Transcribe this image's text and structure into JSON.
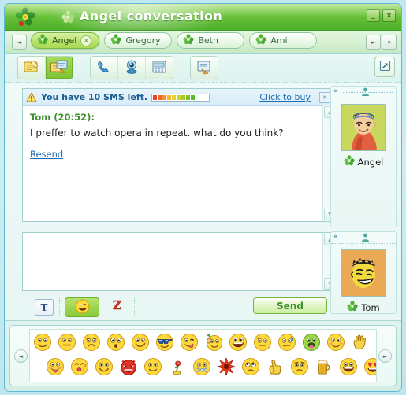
{
  "window": {
    "title": "Angel conversation",
    "logo_icon": "icq-flower-logo",
    "title_icon": "flower-icon",
    "minimize_label": "_",
    "close_label": "x"
  },
  "tabs": {
    "prev_label": "◄",
    "next_label": "►",
    "more_label": "»",
    "items": [
      {
        "label": "Angel",
        "active": true,
        "close_label": "×",
        "icon": "flower-icon"
      },
      {
        "label": "Gregory",
        "active": false,
        "icon": "flower-icon"
      },
      {
        "label": "Beth",
        "active": false,
        "icon": "flower-icon"
      },
      {
        "label": "Ami",
        "active": false,
        "icon": "flower-icon"
      }
    ]
  },
  "toolbar": {
    "buttons": [
      {
        "name": "send-file-button",
        "icon": "yellow-note-icon",
        "pressed": false
      },
      {
        "name": "send-contacts-button",
        "icon": "notes-stack-icon",
        "pressed": true
      },
      {
        "name": "voice-call-button",
        "icon": "phone-icon",
        "pressed": false
      },
      {
        "name": "video-call-button",
        "icon": "webcam-icon",
        "pressed": false
      },
      {
        "name": "send-sms-button",
        "icon": "sms-device-icon",
        "pressed": false
      },
      {
        "name": "history-button",
        "icon": "history-note-icon",
        "pressed": false
      }
    ],
    "expand_icon": "expand-arrow-icon"
  },
  "sms_bar": {
    "warning_icon": "warning-triangle-icon",
    "text": "You have 10 SMS left.",
    "buy_link": "Click to buy",
    "close_label": "×",
    "meter_total": 10,
    "meter_filled": 9,
    "meter_colors": [
      "#e8422a",
      "#f0682c",
      "#f5902e",
      "#f6b92f",
      "#e8cf33",
      "#c9d430",
      "#a6cc2e",
      "#7dc22c",
      "#5cb82b"
    ]
  },
  "conversation": {
    "sender": "Tom (20:52):",
    "message": "I preffer to watch opera in repeat. what do you think?",
    "resend_label": "Resend"
  },
  "message_input": {
    "value": "",
    "placeholder": ""
  },
  "scrollbar": {
    "up_label": "▲",
    "down_label": "▼"
  },
  "contacts": [
    {
      "name": "Angel",
      "avatar": "woman-red-scarf-avatar",
      "status_icon": "flower-icon",
      "collapse_label": "«",
      "header_icon": "person-icon"
    },
    {
      "name": "Tom",
      "avatar": "man-spiky-hair-avatar",
      "status_icon": "flower-icon",
      "collapse_label": "«",
      "header_icon": "person-icon"
    }
  ],
  "actions": {
    "format_label": "T",
    "format_name": "text-format-button",
    "emoticon_icon": "smiley-wink-icon",
    "zoom_icon": "z-letter-icon",
    "send_label": "Send"
  },
  "emoticon_panel": {
    "prev_label": "◄",
    "next_label": "►",
    "row1": [
      "smile",
      "neutral",
      "frown",
      "surprised",
      "grin",
      "sunglasses",
      "tongue-wink",
      "thinking-hand",
      "laugh",
      "unsure",
      "sweat",
      "sick-green",
      "blush-smile",
      "waving-hand"
    ],
    "row2": [
      "blush-tongue",
      "kissing",
      "happy",
      "devil",
      "simple-smile",
      "rose-flower",
      "zipped-mouth",
      "explosion",
      "sad-eyes",
      "thumbs-up",
      "worried",
      "beer-mug",
      "big-grin",
      "heart-eyes"
    ]
  }
}
